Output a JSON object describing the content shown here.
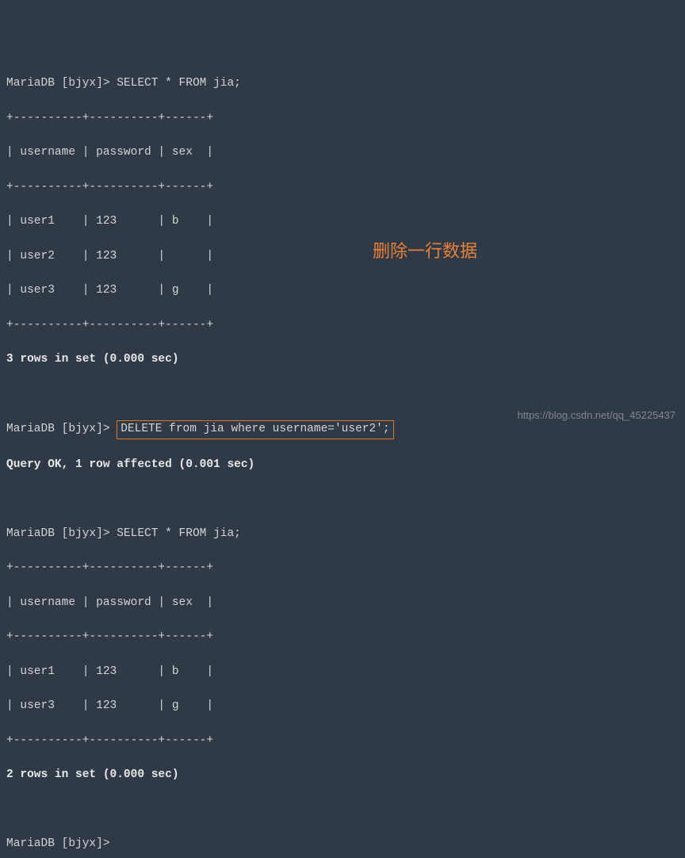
{
  "prompt_label": "MariaDB [bjyx]> ",
  "query1": "SELECT * FROM jia;",
  "table_border": "+----------+----------+------+",
  "table_header": "| username | password | sex  |",
  "rows1": [
    "| user1    | 123      | b    |",
    "| user2    | 123      |      |",
    "| user3    | 123      | g    |"
  ],
  "result1": "3 rows in set (0.000 sec)",
  "query2": "DELETE from jia where username='user2';",
  "result2": "Query OK, 1 row affected (0.001 sec)",
  "query3": "SELECT * FROM jia;",
  "rows2": [
    "| user1    | 123      | b    |",
    "| user3    | 123      | g    |"
  ],
  "result3": "2 rows in set (0.000 sec)",
  "annotation_text": "删除一行数据",
  "watermark_text": "https://blog.csdn.net/qq_45225437"
}
